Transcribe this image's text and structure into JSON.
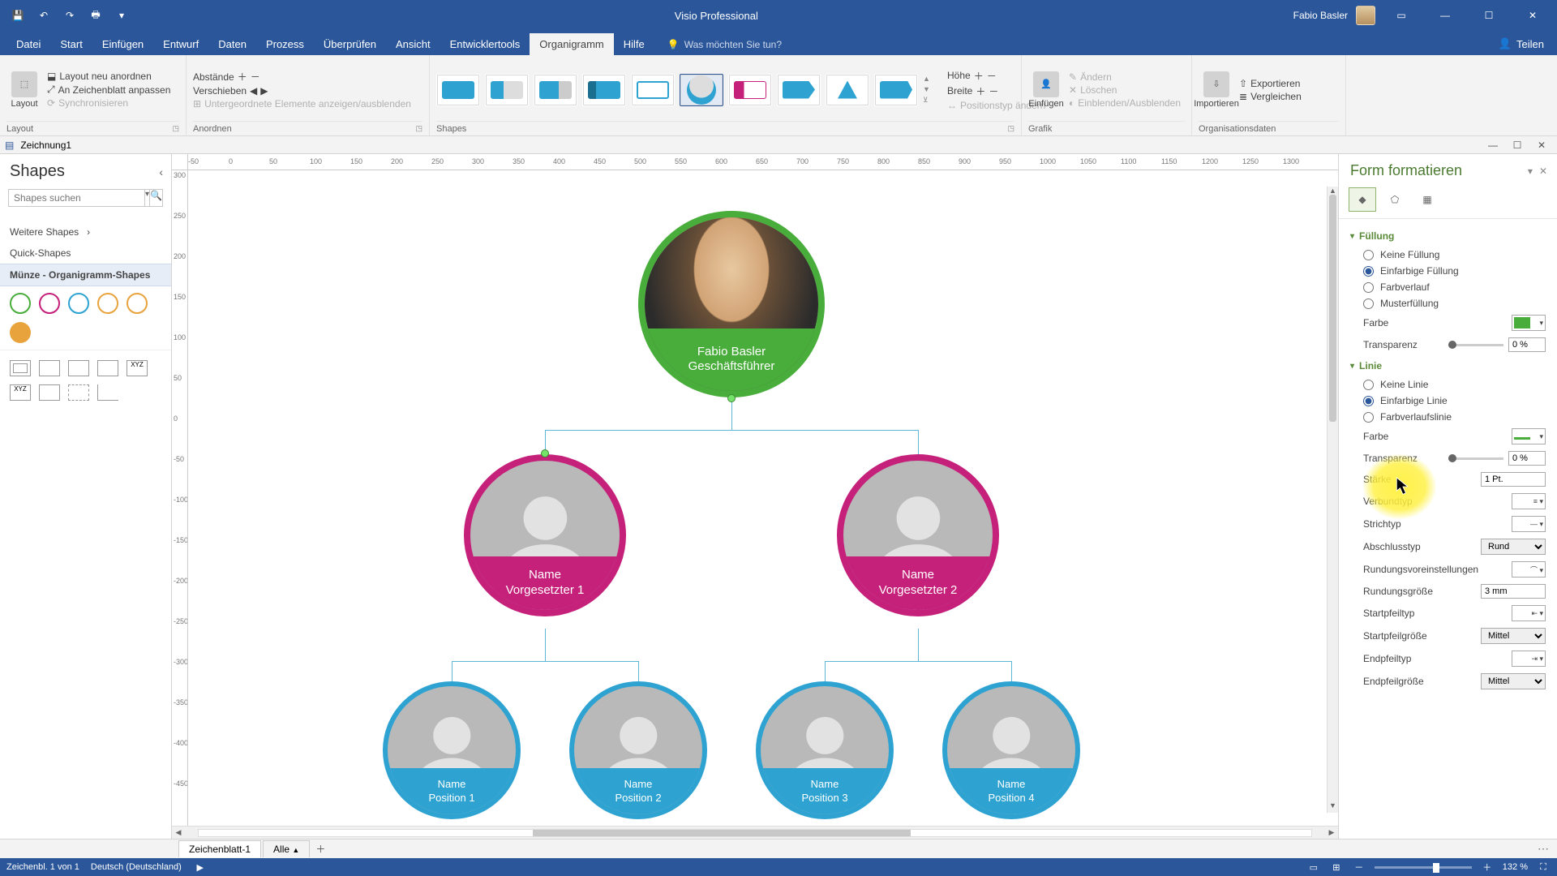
{
  "app": {
    "title": "Visio Professional",
    "user": "Fabio Basler"
  },
  "qat": {
    "save": "💾",
    "undo": "↶",
    "redo": "↷",
    "print": "🖶"
  },
  "tabs": [
    "Datei",
    "Start",
    "Einfügen",
    "Entwurf",
    "Daten",
    "Prozess",
    "Überprüfen",
    "Ansicht",
    "Entwicklertools",
    "Organigramm",
    "Hilfe"
  ],
  "tabs_active_index": 9,
  "tell_me": "Was möchten Sie tun?",
  "share": "Teilen",
  "ribbon": {
    "layout": {
      "big": "Layout",
      "cmd1": "Layout neu anordnen",
      "cmd2": "An Zeichenblatt anpassen",
      "cmd3": "Synchronisieren",
      "group": "Layout"
    },
    "arrange": {
      "spacing": "Abstände",
      "move": "Verschieben",
      "subs": "Untergeordnete Elemente anzeigen/ausblenden",
      "group": "Anordnen"
    },
    "shapes": {
      "group": "Shapes",
      "height": "Höhe",
      "width": "Breite"
    },
    "picture": {
      "insert": "Einfügen",
      "change": "Ändern",
      "delete": "Löschen",
      "toggle": "Einblenden/Ausblenden",
      "postype": "Positionstyp ändern",
      "group": "Grafik"
    },
    "orgdata": {
      "import": "Importieren",
      "export": "Exportieren",
      "compare": "Vergleichen",
      "group": "Organisationsdaten"
    }
  },
  "doc_tab": "Zeichnung1",
  "shapes_panel": {
    "title": "Shapes",
    "search_placeholder": "Shapes suchen",
    "more": "Weitere Shapes",
    "quick": "Quick-Shapes",
    "stencil": "Münze - Organigramm-Shapes"
  },
  "org": {
    "root": {
      "name": "Fabio Basler",
      "role": "Geschäftsführer",
      "color": "#49ad3b"
    },
    "mgrs": [
      {
        "name": "Name",
        "role": "Vorgesetzter 1",
        "color": "#c5207a"
      },
      {
        "name": "Name",
        "role": "Vorgesetzter 2",
        "color": "#c5207a"
      }
    ],
    "staff": [
      {
        "name": "Name",
        "role": "Position 1",
        "color": "#2ea3d2"
      },
      {
        "name": "Name",
        "role": "Position 2",
        "color": "#2ea3d2"
      },
      {
        "name": "Name",
        "role": "Position 3",
        "color": "#2ea3d2"
      },
      {
        "name": "Name",
        "role": "Position 4",
        "color": "#2ea3d2"
      }
    ]
  },
  "ruler_h": [
    "-50",
    "0",
    "50",
    "100",
    "150",
    "200",
    "250",
    "300",
    "350",
    "400",
    "450",
    "500",
    "550",
    "600",
    "650",
    "700",
    "750",
    "800",
    "850",
    "900",
    "950",
    "1000",
    "1050",
    "1100",
    "1150",
    "1200",
    "1250",
    "1300"
  ],
  "ruler_v": [
    "300",
    "250",
    "200",
    "150",
    "100",
    "50",
    "0",
    "-50",
    "-100",
    "-150",
    "-200",
    "-250",
    "-300",
    "-350",
    "-400",
    "-450"
  ],
  "sheets": {
    "s1": "Zeichenblatt-1",
    "all": "Alle"
  },
  "status": {
    "page": "Zeichenbl. 1 von 1",
    "lang": "Deutsch (Deutschland)",
    "zoom": "132 %"
  },
  "format": {
    "title": "Form formatieren",
    "fill": {
      "h": "Füllung",
      "none": "Keine Füllung",
      "solid": "Einfarbige Füllung",
      "grad": "Farbverlauf",
      "patt": "Musterfüllung",
      "color": "Farbe",
      "trans": "Transparenz",
      "trans_v": "0 %"
    },
    "line": {
      "h": "Linie",
      "none": "Keine Linie",
      "solid": "Einfarbige Linie",
      "grad": "Farbverlaufslinie",
      "color": "Farbe",
      "trans": "Transparenz",
      "trans_v": "0 %",
      "width": "Stärke",
      "width_v": "1 Pt.",
      "compound": "Verbundtyp",
      "dash": "Strichtyp",
      "cap": "Abschlusstyp",
      "cap_v": "Rund",
      "round_pre": "Rundungsvoreinstellungen",
      "round_size": "Rundungsgröße",
      "round_size_v": "3 mm",
      "begin_t": "Startpfeiltyp",
      "begin_s": "Startpfeilgröße",
      "begin_s_v": "Mittel",
      "end_t": "Endpfeiltyp",
      "end_s": "Endpfeilgröße",
      "end_s_v": "Mittel"
    }
  }
}
